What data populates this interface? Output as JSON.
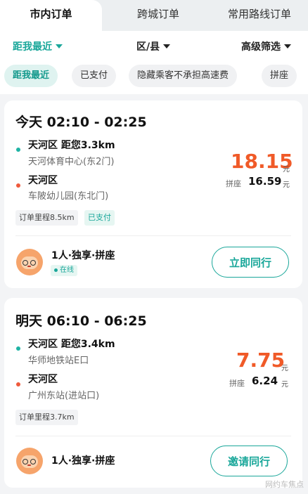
{
  "tabs": [
    {
      "label": "市内订单"
    },
    {
      "label": "跨城订单"
    },
    {
      "label": "常用路线订单"
    }
  ],
  "filters": {
    "sort_label": "距我最近",
    "district_label": "区/县",
    "advanced_label": "高级筛选"
  },
  "chips": [
    {
      "label": "距我最近"
    },
    {
      "label": "已支付"
    },
    {
      "label": "隐藏乘客不承担高速费"
    },
    {
      "label": "拼座"
    }
  ],
  "orders": [
    {
      "time": "今天 02:10 - 02:25",
      "start_title": "天河区  距您3.3km",
      "start_sub": "天河体育中心(东2门)",
      "end_title": "天河区",
      "end_sub": "车陂幼儿园(东北门)",
      "price": "18.15",
      "price_unit": "元",
      "carpool_label": "拼座",
      "carpool_price": "16.59",
      "carpool_unit": "元",
      "tags": [
        "订单里程8.5km",
        "已支付"
      ],
      "rider": "1人·独享·拼座",
      "status": "在线",
      "button": "立即同行"
    },
    {
      "time": "明天 06:10 - 06:25",
      "start_title": "天河区  距您3.4km",
      "start_sub": "华师地铁站E口",
      "end_title": "天河区",
      "end_sub": "广州东站(进站口)",
      "price": "7.75",
      "price_unit": "元",
      "carpool_label": "拼座",
      "carpool_price": "6.24",
      "carpool_unit": "元",
      "tags": [
        "订单里程3.7km"
      ],
      "rider": "1人·独享·拼座",
      "button": "邀请同行"
    }
  ],
  "watermark": "网约车焦点",
  "colors": {
    "accent": "#1aa79a",
    "price": "#f05a28"
  }
}
